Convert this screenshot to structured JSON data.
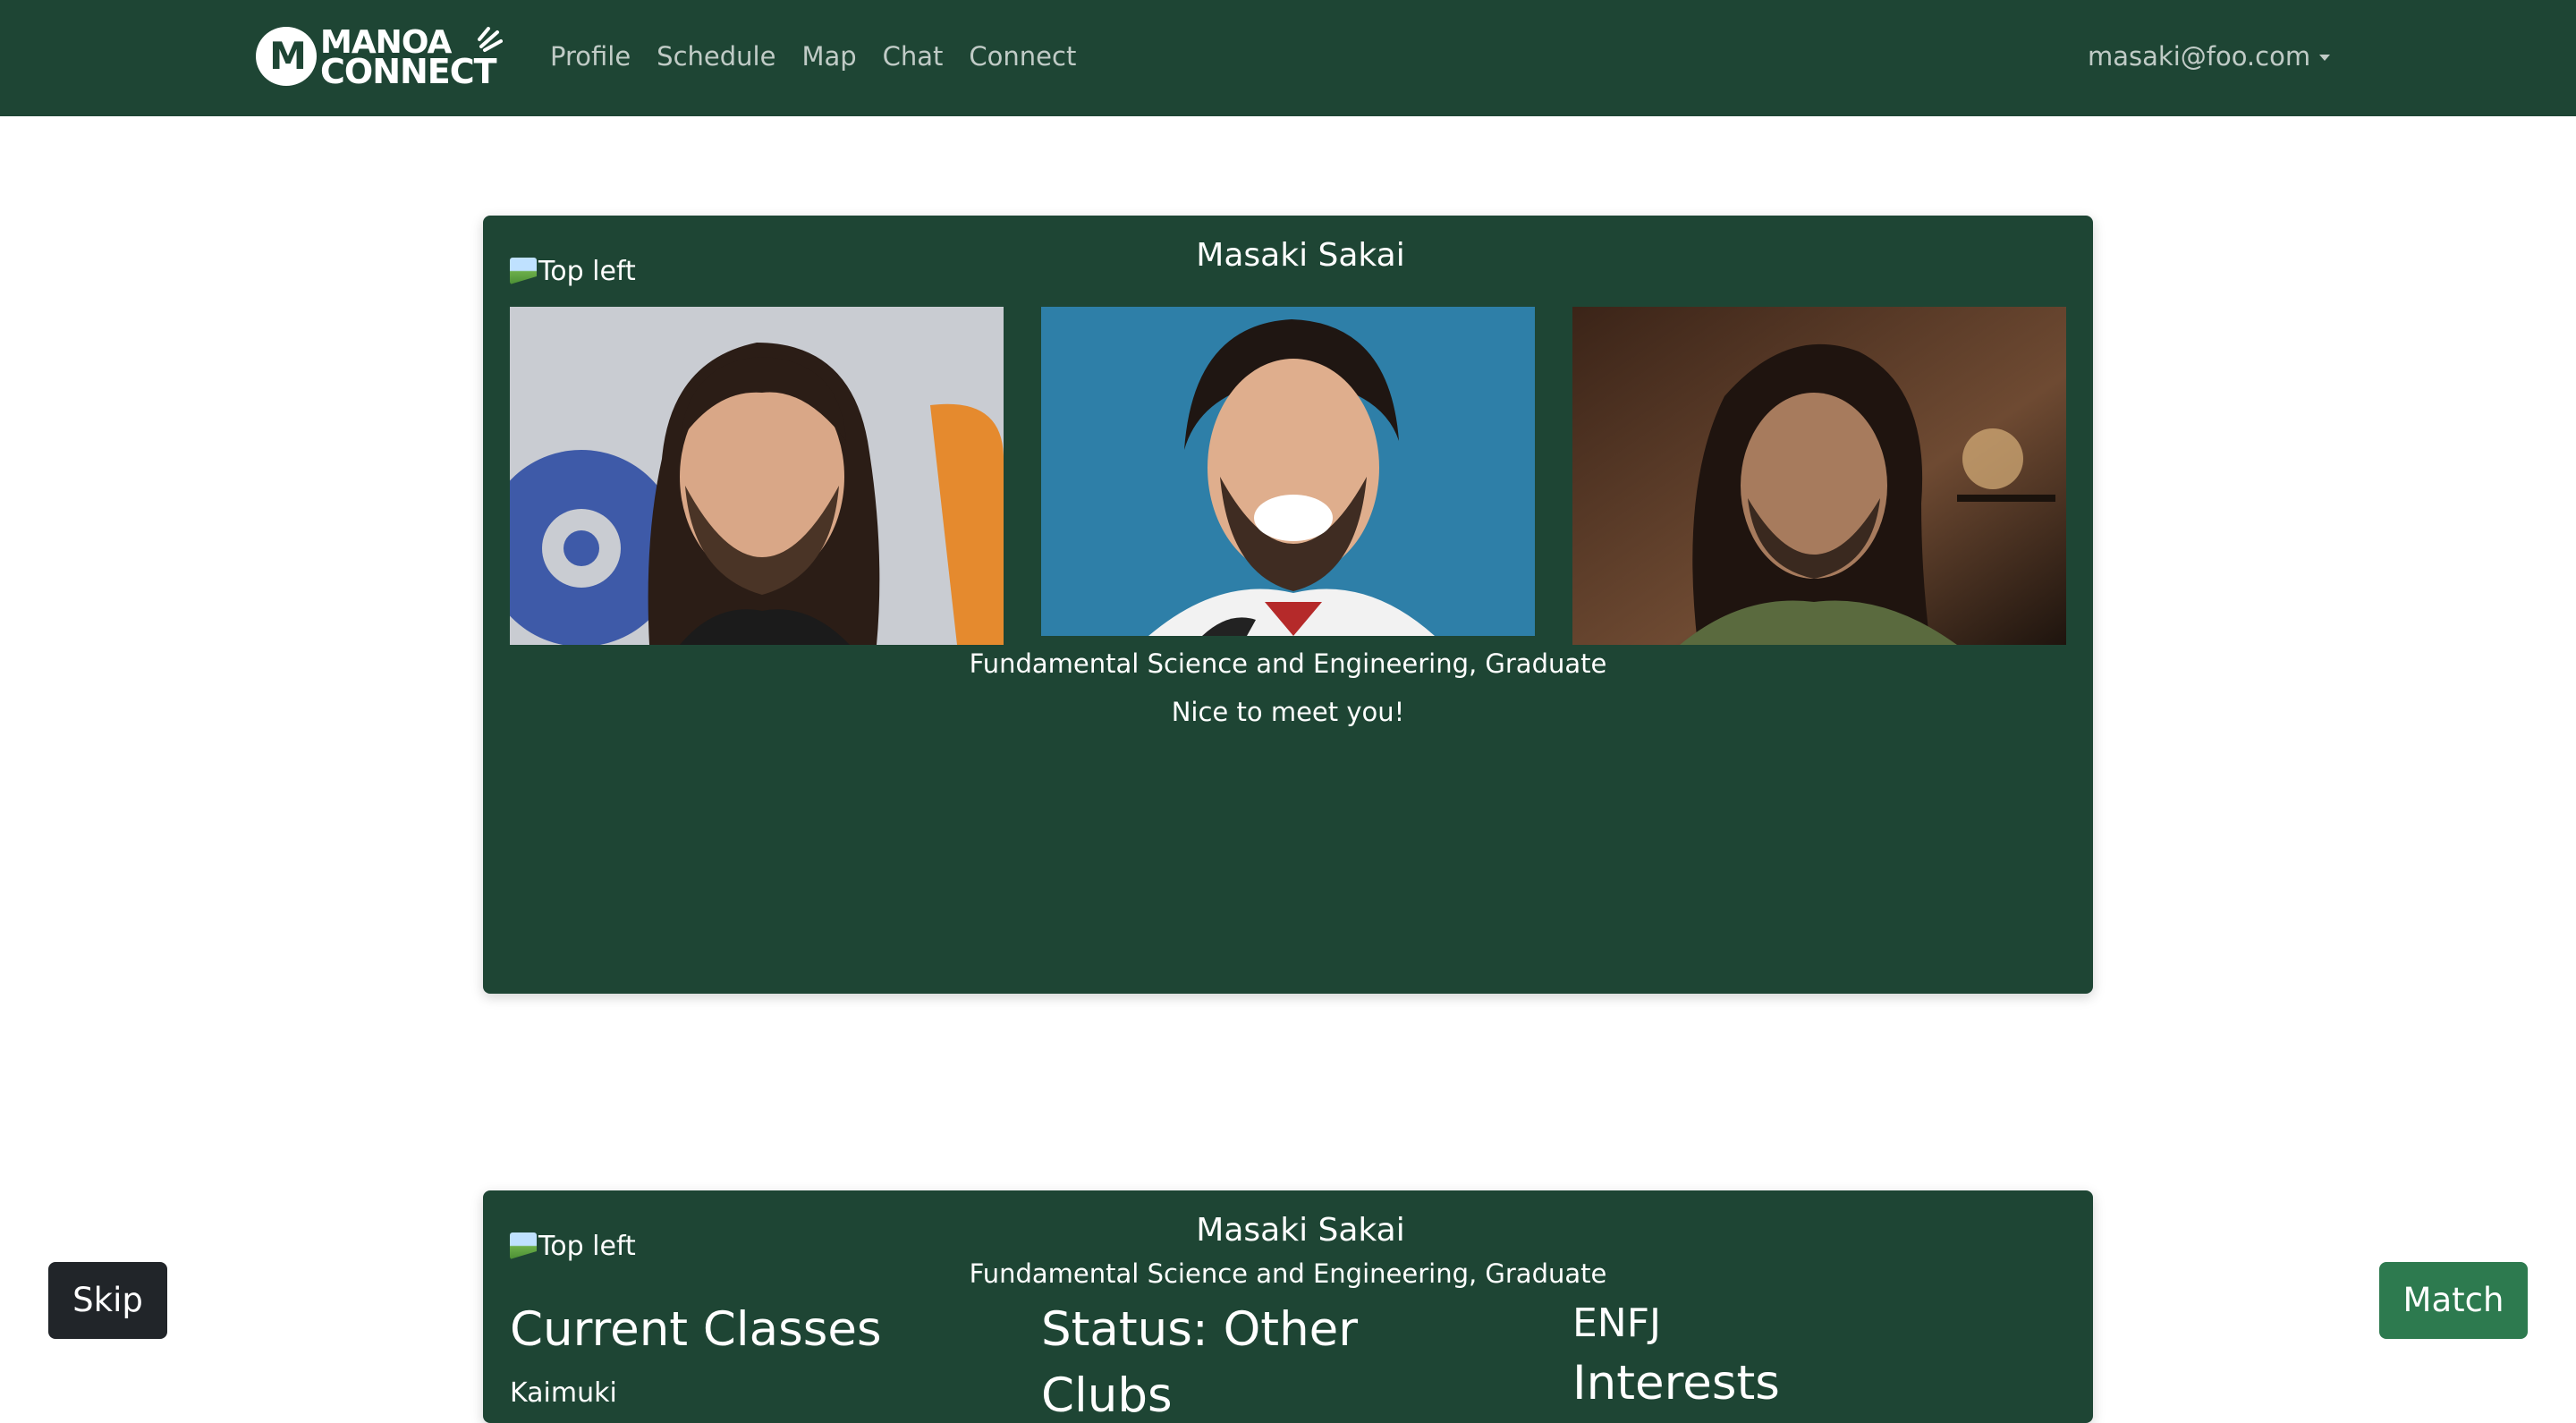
{
  "navbar": {
    "brand_line1": "MANOA",
    "brand_line2": "CONNECT",
    "links": [
      "Profile",
      "Schedule",
      "Map",
      "Chat",
      "Connect"
    ],
    "user_email": "masaki@foo.com"
  },
  "card1": {
    "image_alt": "Top left",
    "name": "Masaki Sakai",
    "major": "Fundamental Science and Engineering, Graduate",
    "bio": "Nice to meet you!"
  },
  "card2": {
    "image_alt": "Top left",
    "name": "Masaki Sakai",
    "major": "Fundamental Science and Engineering, Graduate",
    "current_classes_heading": "Current Classes",
    "class_partial": "Kaimuki",
    "status": "Status: Other",
    "clubs_partial": "Clubs",
    "personality": "ENFJ",
    "interests_partial": "Interests"
  },
  "actions": {
    "skip": "Skip",
    "match": "Match"
  },
  "colors": {
    "brand_green": "#1e4534",
    "match_green": "#2d7a4f",
    "skip_dark": "#212529"
  }
}
